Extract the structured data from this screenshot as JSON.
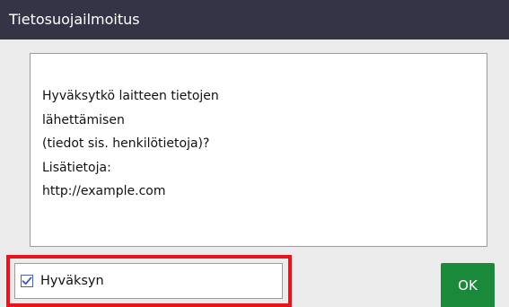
{
  "dialog": {
    "title": "Tietosuojailmoitus"
  },
  "message": {
    "text": "Hyväksytkö laitteen tietojen\nlähettämisen\n(tiedot sis. henkilötietoja)?\nLisätietoja:\nhttp://example.com"
  },
  "consent": {
    "label": "Hyväksyn",
    "checked": true,
    "highlight_color": "#e8141c"
  },
  "actions": {
    "ok_label": "OK",
    "ok_color": "#1a8a3a"
  }
}
